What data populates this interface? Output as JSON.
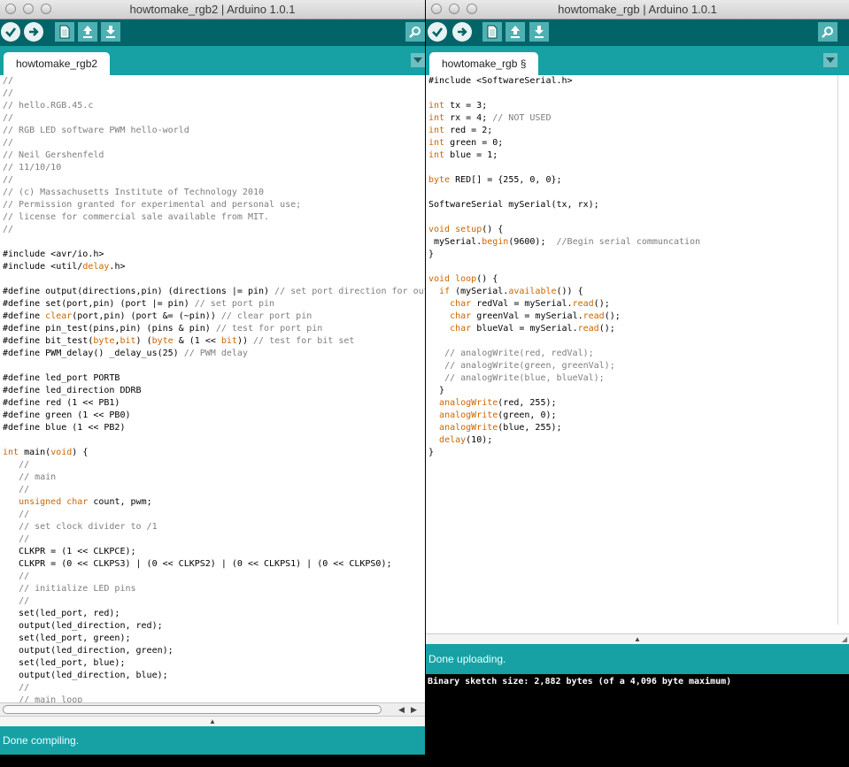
{
  "left_window": {
    "title": "howtomake_rgb2 | Arduino 1.0.1",
    "tab": "howtomake_rgb2",
    "status": "Done compiling.",
    "code": [
      [
        {
          "t": "//",
          "c": "cm"
        }
      ],
      [
        {
          "t": "//",
          "c": "cm"
        }
      ],
      [
        {
          "t": "// hello.RGB.45.c",
          "c": "cm"
        }
      ],
      [
        {
          "t": "//",
          "c": "cm"
        }
      ],
      [
        {
          "t": "// RGB LED software PWM hello-world",
          "c": "cm"
        }
      ],
      [
        {
          "t": "//",
          "c": "cm"
        }
      ],
      [
        {
          "t": "// Neil Gershenfeld",
          "c": "cm"
        }
      ],
      [
        {
          "t": "// 11/10/10",
          "c": "cm"
        }
      ],
      [
        {
          "t": "//",
          "c": "cm"
        }
      ],
      [
        {
          "t": "// (c) Massachusetts Institute of Technology 2010",
          "c": "cm"
        }
      ],
      [
        {
          "t": "// Permission granted for experimental and personal use;",
          "c": "cm"
        }
      ],
      [
        {
          "t": "// license for commercial sale available from MIT.",
          "c": "cm"
        }
      ],
      [
        {
          "t": "//",
          "c": "cm"
        }
      ],
      [],
      [
        {
          "t": "#include <avr/io.h>"
        }
      ],
      [
        {
          "t": "#include <util/"
        },
        {
          "t": "delay",
          "c": "kw"
        },
        {
          "t": ".h>"
        }
      ],
      [],
      [
        {
          "t": "#define output(directions,pin) (directions |= pin) "
        },
        {
          "t": "// set port direction for output",
          "c": "cm"
        }
      ],
      [
        {
          "t": "#define set(port,pin) (port |= pin) "
        },
        {
          "t": "// set port pin",
          "c": "cm"
        }
      ],
      [
        {
          "t": "#define "
        },
        {
          "t": "clear",
          "c": "kw"
        },
        {
          "t": "(port,pin) (port &= (~pin)) "
        },
        {
          "t": "// clear port pin",
          "c": "cm"
        }
      ],
      [
        {
          "t": "#define pin_test(pins,pin) (pins & pin) "
        },
        {
          "t": "// test for port pin",
          "c": "cm"
        }
      ],
      [
        {
          "t": "#define bit_test("
        },
        {
          "t": "byte",
          "c": "kw"
        },
        {
          "t": ","
        },
        {
          "t": "bit",
          "c": "kw"
        },
        {
          "t": ") ("
        },
        {
          "t": "byte",
          "c": "kw"
        },
        {
          "t": " & (1 << "
        },
        {
          "t": "bit",
          "c": "kw"
        },
        {
          "t": ")) "
        },
        {
          "t": "// test for bit set",
          "c": "cm"
        }
      ],
      [
        {
          "t": "#define PWM_delay() _delay_us(25) "
        },
        {
          "t": "// PWM delay",
          "c": "cm"
        }
      ],
      [],
      [
        {
          "t": "#define led_port PORTB"
        }
      ],
      [
        {
          "t": "#define led_direction DDRB"
        }
      ],
      [
        {
          "t": "#define red (1 << PB1)"
        }
      ],
      [
        {
          "t": "#define green (1 << PB0)"
        }
      ],
      [
        {
          "t": "#define blue (1 << PB2)"
        }
      ],
      [],
      [
        {
          "t": "int",
          "c": "kw"
        },
        {
          "t": " main("
        },
        {
          "t": "void",
          "c": "kw"
        },
        {
          "t": ") {"
        }
      ],
      [
        {
          "t": "   "
        },
        {
          "t": "//",
          "c": "cm"
        }
      ],
      [
        {
          "t": "   "
        },
        {
          "t": "// main",
          "c": "cm"
        }
      ],
      [
        {
          "t": "   "
        },
        {
          "t": "//",
          "c": "cm"
        }
      ],
      [
        {
          "t": "   "
        },
        {
          "t": "unsigned",
          "c": "kw"
        },
        {
          "t": " "
        },
        {
          "t": "char",
          "c": "kw"
        },
        {
          "t": " count, pwm;"
        }
      ],
      [
        {
          "t": "   "
        },
        {
          "t": "//",
          "c": "cm"
        }
      ],
      [
        {
          "t": "   "
        },
        {
          "t": "// set clock divider to /1",
          "c": "cm"
        }
      ],
      [
        {
          "t": "   "
        },
        {
          "t": "//",
          "c": "cm"
        }
      ],
      [
        {
          "t": "   CLKPR = (1 << CLKPCE);"
        }
      ],
      [
        {
          "t": "   CLKPR = (0 << CLKPS3) | (0 << CLKPS2) | (0 << CLKPS1) | (0 << CLKPS0);"
        }
      ],
      [
        {
          "t": "   "
        },
        {
          "t": "//",
          "c": "cm"
        }
      ],
      [
        {
          "t": "   "
        },
        {
          "t": "// initialize LED pins",
          "c": "cm"
        }
      ],
      [
        {
          "t": "   "
        },
        {
          "t": "//",
          "c": "cm"
        }
      ],
      [
        {
          "t": "   set(led_port, red);"
        }
      ],
      [
        {
          "t": "   output(led_direction, red);"
        }
      ],
      [
        {
          "t": "   set(led_port, green);"
        }
      ],
      [
        {
          "t": "   output(led_direction, green);"
        }
      ],
      [
        {
          "t": "   set(led_port, blue);"
        }
      ],
      [
        {
          "t": "   output(led_direction, blue);"
        }
      ],
      [
        {
          "t": "   "
        },
        {
          "t": "//",
          "c": "cm"
        }
      ],
      [
        {
          "t": "   "
        },
        {
          "t": "// main loop",
          "c": "cm"
        }
      ]
    ]
  },
  "right_window": {
    "title": "howtomake_rgb | Arduino 1.0.1",
    "tab": "howtomake_rgb §",
    "status": "Done uploading.",
    "console": "Binary sketch size: 2,882 bytes (of a 4,096 byte maximum)",
    "code": [
      [
        {
          "t": "#include <SoftwareSerial.h>"
        }
      ],
      [],
      [
        {
          "t": "int",
          "c": "kw"
        },
        {
          "t": " tx = 3;"
        }
      ],
      [
        {
          "t": "int",
          "c": "kw"
        },
        {
          "t": " rx = 4; "
        },
        {
          "t": "// NOT USED",
          "c": "cm"
        }
      ],
      [
        {
          "t": "int",
          "c": "kw"
        },
        {
          "t": " red = 2;"
        }
      ],
      [
        {
          "t": "int",
          "c": "kw"
        },
        {
          "t": " green = 0;"
        }
      ],
      [
        {
          "t": "int",
          "c": "kw"
        },
        {
          "t": " blue = 1;"
        }
      ],
      [],
      [
        {
          "t": "byte",
          "c": "kw"
        },
        {
          "t": " RED[] = {255, 0, 0};"
        }
      ],
      [],
      [
        {
          "t": "SoftwareSerial mySerial(tx, rx);"
        }
      ],
      [],
      [
        {
          "t": "void",
          "c": "kw"
        },
        {
          "t": " "
        },
        {
          "t": "setup",
          "c": "kw"
        },
        {
          "t": "() {"
        }
      ],
      [
        {
          "t": " mySerial."
        },
        {
          "t": "begin",
          "c": "kw"
        },
        {
          "t": "(9600);  "
        },
        {
          "t": "//Begin serial communcation",
          "c": "cm"
        }
      ],
      [
        {
          "t": "}"
        }
      ],
      [],
      [
        {
          "t": "void",
          "c": "kw"
        },
        {
          "t": " "
        },
        {
          "t": "loop",
          "c": "kw"
        },
        {
          "t": "() {"
        }
      ],
      [
        {
          "t": "  "
        },
        {
          "t": "if",
          "c": "kw"
        },
        {
          "t": " (mySerial."
        },
        {
          "t": "available",
          "c": "kw"
        },
        {
          "t": "()) {"
        }
      ],
      [
        {
          "t": "    "
        },
        {
          "t": "char",
          "c": "kw"
        },
        {
          "t": " redVal = mySerial."
        },
        {
          "t": "read",
          "c": "kw"
        },
        {
          "t": "();"
        }
      ],
      [
        {
          "t": "    "
        },
        {
          "t": "char",
          "c": "kw"
        },
        {
          "t": " greenVal = mySerial."
        },
        {
          "t": "read",
          "c": "kw"
        },
        {
          "t": "();"
        }
      ],
      [
        {
          "t": "    "
        },
        {
          "t": "char",
          "c": "kw"
        },
        {
          "t": " blueVal = mySerial."
        },
        {
          "t": "read",
          "c": "kw"
        },
        {
          "t": "();"
        }
      ],
      [],
      [
        {
          "t": "   "
        },
        {
          "t": "// analogWrite(red, redVal);",
          "c": "cm"
        }
      ],
      [
        {
          "t": "   "
        },
        {
          "t": "// analogWrite(green, greenVal);",
          "c": "cm"
        }
      ],
      [
        {
          "t": "   "
        },
        {
          "t": "// analogWrite(blue, blueVal);",
          "c": "cm"
        }
      ],
      [
        {
          "t": "  }"
        }
      ],
      [
        {
          "t": "  "
        },
        {
          "t": "analogWrite",
          "c": "kw"
        },
        {
          "t": "(red, 255);"
        }
      ],
      [
        {
          "t": "  "
        },
        {
          "t": "analogWrite",
          "c": "kw"
        },
        {
          "t": "(green, 0);"
        }
      ],
      [
        {
          "t": "  "
        },
        {
          "t": "analogWrite",
          "c": "kw"
        },
        {
          "t": "(blue, 255);"
        }
      ],
      [
        {
          "t": "  "
        },
        {
          "t": "delay",
          "c": "kw"
        },
        {
          "t": "(10);"
        }
      ],
      [
        {
          "t": "}"
        }
      ]
    ]
  },
  "colors": {
    "toolbar": "#006468",
    "tabbar": "#17a1a5",
    "keyword": "#cc6600",
    "comment": "#7e7e7e"
  },
  "icons": [
    "verify-icon",
    "upload-icon",
    "new-icon",
    "open-icon",
    "save-icon",
    "serial-monitor-icon",
    "tab-menu-icon"
  ]
}
